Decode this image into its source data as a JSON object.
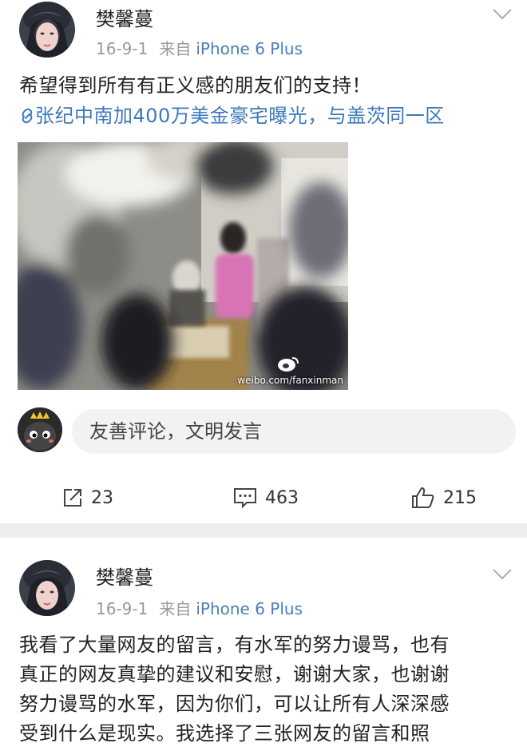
{
  "posts": [
    {
      "username": "樊馨蔓",
      "date": "16-9-1",
      "from_label": "来自",
      "device": "iPhone 6 Plus",
      "text_lines": [
        "希望得到所有有正义感的朋友们的支持！"
      ],
      "link_text": "张纪中南加400万美金豪宅曝光，与盖茨同一区",
      "image_watermark": "weibo.com/fanxinman",
      "comment_placeholder": "友善评论，文明发言",
      "repost_count": "23",
      "comment_count": "463",
      "like_count": "215"
    },
    {
      "username": "樊馨蔓",
      "date": "16-9-1",
      "from_label": "来自",
      "device": "iPhone 6 Plus",
      "text_lines": [
        "我看了大量网友的留言，有水军的努力谩骂，也有",
        "真正的网友真挚的建议和安慰，谢谢大家，也谢谢",
        "努力谩骂的水军，因为你们，可以让所有人深深感",
        "受到什么是现实。我选择了三张网友的留言和照"
      ]
    }
  ],
  "colors": {
    "link": "#3e78b9",
    "meta": "#999999",
    "divider": "#eeeeee"
  }
}
